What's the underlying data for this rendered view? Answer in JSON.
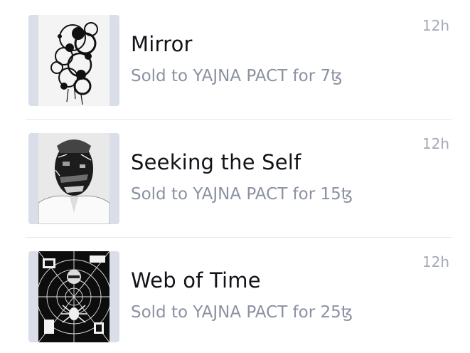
{
  "activity": {
    "items": [
      {
        "title": "Mirror",
        "subtitle": "Sold to YAJNA PACT for 7ꜩ",
        "time": "12h",
        "artwork_icon": "abstract-ink-circles-artwork"
      },
      {
        "title": "Seeking the Self",
        "subtitle": "Sold to YAJNA PACT for 15ꜩ",
        "time": "12h",
        "artwork_icon": "abstract-face-portrait-artwork"
      },
      {
        "title": "Web of Time",
        "subtitle": "Sold to YAJNA PACT for 25ꜩ",
        "time": "12h",
        "artwork_icon": "spider-web-collage-artwork"
      }
    ]
  },
  "colors": {
    "thumb_background": "#d9dee9",
    "title_text": "#111318",
    "subtitle_text": "#8a91a1",
    "timestamp_text": "#a3a9b6",
    "divider": "#e6e8ed"
  }
}
